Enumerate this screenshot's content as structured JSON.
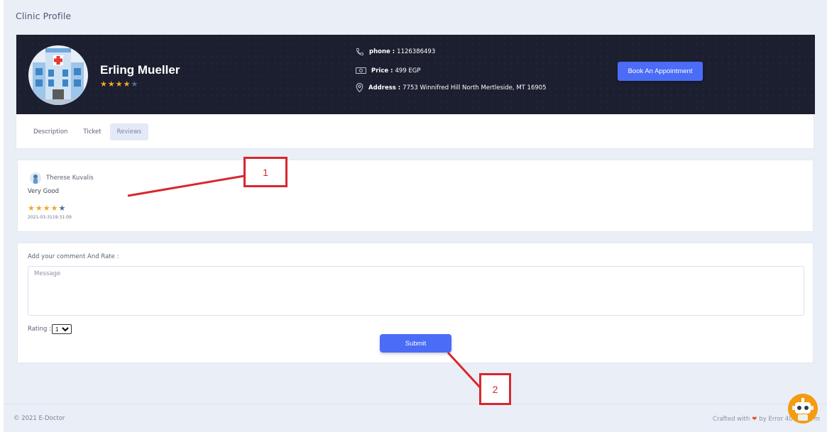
{
  "page": {
    "title": "Clinic Profile"
  },
  "profile": {
    "name": "Erling Mueller",
    "rating": 4,
    "max_rating": 5,
    "phone_label": "phone :",
    "phone_value": "1126386493",
    "price_label": "Price :",
    "price_value": "499 EGP",
    "address_label": "Address :",
    "address_value": "7753 Winnifred Hill North Mertleside, MT 16905",
    "book_label": "Book An Appointment"
  },
  "tabs": [
    {
      "label": "Description",
      "active": false
    },
    {
      "label": "Ticket",
      "active": false
    },
    {
      "label": "Reviews",
      "active": true
    }
  ],
  "review": {
    "author": "Therese Kuvalis",
    "text": "Very Good",
    "rating": 4,
    "max_rating": 5,
    "date": "2021-03-3119:31:09"
  },
  "comment_form": {
    "label": "Add your comment And Rate :",
    "message_placeholder": "Message",
    "rating_label": "Rating :",
    "rating_value": "1",
    "submit_label": "Submit"
  },
  "footer": {
    "copyright": "© 2021 E-Doctor",
    "crafted_prefix": "Crafted with",
    "crafted_suffix": "by Error 40",
    "crafted_end": "m"
  },
  "annotations": [
    {
      "label": "1"
    },
    {
      "label": "2"
    }
  ],
  "colors": {
    "accent": "#4a6cf7",
    "hero_bg": "#1c1f30",
    "star": "#f5a623",
    "annotation": "#d7282f"
  },
  "icons": [
    "hospital-icon",
    "phone-icon",
    "money-icon",
    "location-icon",
    "chevron-down-icon",
    "heart-icon",
    "chatbot-icon"
  ]
}
